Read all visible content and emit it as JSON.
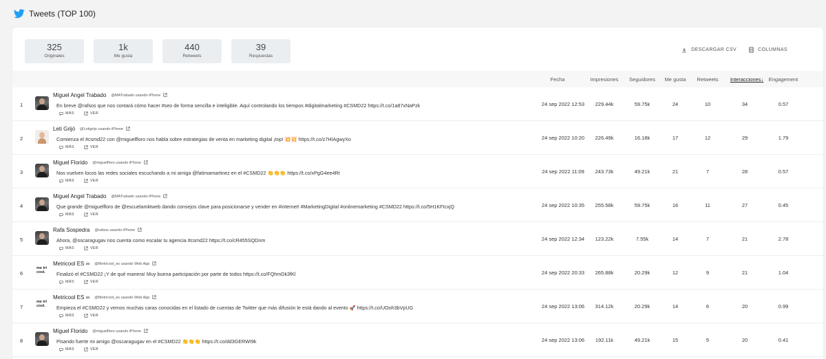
{
  "header": {
    "title": "Tweets (TOP 100)",
    "icon": "twitter-bird-icon",
    "icon_color": "#1da1f2"
  },
  "stats": [
    {
      "value": "325",
      "label": "Originales"
    },
    {
      "value": "1k",
      "label": "Me gusta"
    },
    {
      "value": "440",
      "label": "Retweets"
    },
    {
      "value": "39",
      "label": "Respuestas"
    }
  ],
  "actions": {
    "download": "DESCARGAR CSV",
    "columns": "COLUMNAS"
  },
  "columns": {
    "fecha": "Fecha",
    "impresiones": "Impresiones",
    "seguidores": "Seguidores",
    "megusta": "Me gusta",
    "retweets": "Retweets",
    "interacciones": "Interacciones",
    "engagement": "Engagement",
    "sort_arrow": "↓"
  },
  "row_links": {
    "more": "MÁS",
    "view": "VER"
  },
  "rows": [
    {
      "idx": "1",
      "name": "Miguel Angel Trabado",
      "handle": "@MATrabado usando iPhone",
      "text": "En breve @rafsos que nos contará cómo hacer #seo de forma sencilla e inteligible. Aquí controlando los tiempos #digitalmarketing #CSMD22 https://t.co/1a87xNaPzk",
      "fecha": "24 sep 2022 12:53",
      "impresiones": "229.44k",
      "seguidores": "59.75k",
      "megusta": "24",
      "retweets": "10",
      "interacciones": "34",
      "engagement": "0.57",
      "avatar": "photo"
    },
    {
      "idx": "2",
      "name": "Leti Grijó",
      "handle": "@Letigrijo usando iPhone",
      "text": "Comienza el #csmd22 con @miguelfloro nos habla sobre estrategias de venta en marketing digital ¡top! 💥💥 https://t.co/z7HIAgwyXo",
      "fecha": "24 sep 2022 10:20",
      "impresiones": "226.49k",
      "seguidores": "16.18k",
      "megusta": "17",
      "retweets": "12",
      "interacciones": "29",
      "engagement": "1.79",
      "avatar": "light"
    },
    {
      "idx": "3",
      "name": "Miguel Florido",
      "handle": "@miguelfloro usando iPhone",
      "text": "Nos vuelven locos las redes sociales escuchando a mi amiga @fatimamartinez en el #CSMD22 👏👏👏 https://t.co/xPgG4ee4Rt",
      "fecha": "24 sep 2022 11:09",
      "impresiones": "243.73k",
      "seguidores": "49.21k",
      "megusta": "21",
      "retweets": "7",
      "interacciones": "28",
      "engagement": "0.57",
      "avatar": "photo"
    },
    {
      "idx": "4",
      "name": "Miguel Angel Trabado",
      "handle": "@MATrabado usando iPhone",
      "text": "Que grande @miguelfloro de @escuelamktweb dando consejos clave para posicionarse y vender en #internet! #MarketingDigital #onlinemarketing #CSMD22 https://t.co/5H1KFIcxjQ",
      "fecha": "24 sep 2022 10:35",
      "impresiones": "255.58k",
      "seguidores": "59.75k",
      "megusta": "16",
      "retweets": "11",
      "interacciones": "27",
      "engagement": "0.45",
      "avatar": "photo"
    },
    {
      "idx": "5",
      "name": "Rafa Sospedra",
      "handle": "@rafsos usando iPhone",
      "text": "Ahora, @oscaragugav nos cuenta como escalar tu agencia #csmd22 https://t.co/cR455SQDnm",
      "fecha": "24 sep 2022 12:34",
      "impresiones": "123.22k",
      "seguidores": "7.55k",
      "megusta": "14",
      "retweets": "7",
      "interacciones": "21",
      "engagement": "2.78",
      "avatar": "photo"
    },
    {
      "idx": "6",
      "name": "Metricool ES ∞",
      "handle": "@Metricool_es usando Web App",
      "text": "Finalizó el #CSMD22 ¡Y de qué manera! Muy buena participación por parte de todos https://t.co/FQhmDk3fKl",
      "fecha": "24 sep 2022 20:33",
      "impresiones": "265.88k",
      "seguidores": "20.29k",
      "megusta": "12",
      "retweets": "9",
      "interacciones": "21",
      "engagement": "1.04",
      "avatar": "logo",
      "logo_text": "me tri cool."
    },
    {
      "idx": "7",
      "name": "Metricool ES ∞",
      "handle": "@Metricool_es usando Web App",
      "text": "Empieza el #CSMD22 y vemos muchas caras conocidas en el listado de cuentas de Twitter que más difusión le está dando al evento 🚀 https://t.co/UOoh3bVpUG",
      "fecha": "24 sep 2022 13:06",
      "impresiones": "314.12k",
      "seguidores": "20.29k",
      "megusta": "14",
      "retweets": "6",
      "interacciones": "20",
      "engagement": "0.99",
      "avatar": "logo",
      "logo_text": "me tri cool."
    },
    {
      "idx": "8",
      "name": "Miguel Florido",
      "handle": "@miguelfloro usando iPhone",
      "text": "Pisando fuerte mi amigo @oscaragugav en el #CSMD22 👏👏👏 https://t.co/dd3GERWI9k",
      "fecha": "24 sep 2022 13:06",
      "impresiones": "192.11k",
      "seguidores": "49.21k",
      "megusta": "15",
      "retweets": "5",
      "interacciones": "20",
      "engagement": "0.41",
      "avatar": "photo"
    }
  ]
}
